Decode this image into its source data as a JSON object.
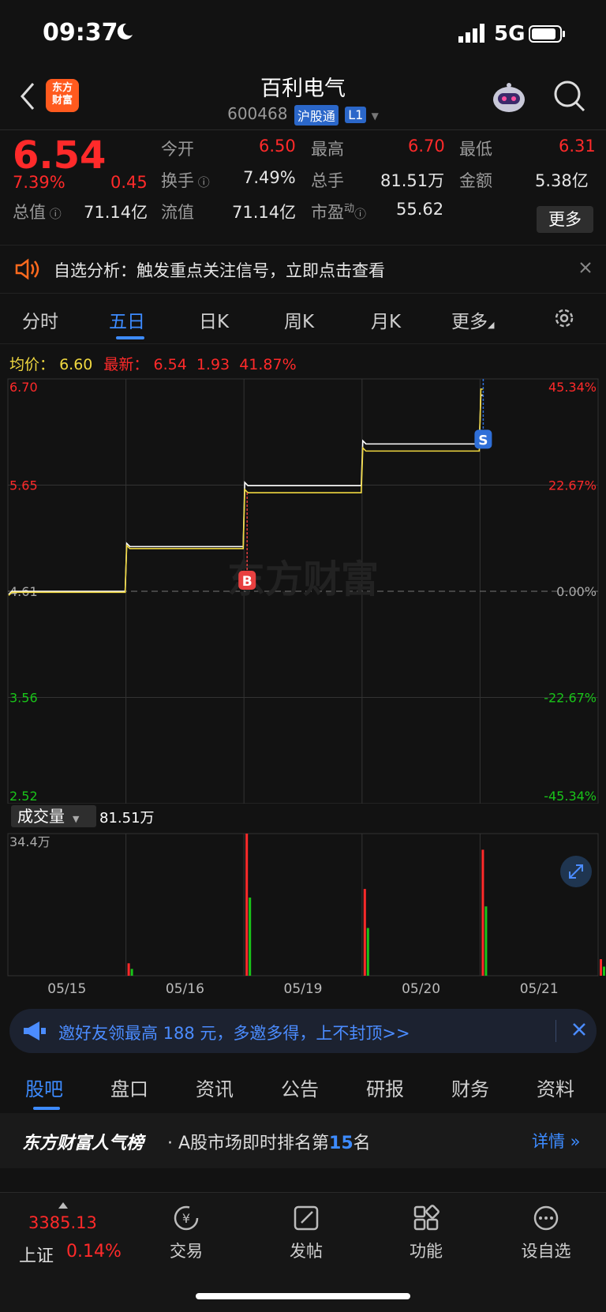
{
  "status": {
    "time": "09:37",
    "network": "5G"
  },
  "header": {
    "logo_line1": "东方",
    "logo_line2": "财富",
    "stock_name": "百利电气",
    "stock_code": "600468",
    "tag_connect": "沪股通",
    "tag_level": "L1"
  },
  "quote": {
    "price": "6.54",
    "change_pct": "7.39%",
    "change": "0.45",
    "open_label": "今开",
    "open": "6.50",
    "high_label": "最高",
    "high": "6.70",
    "low_label": "最低",
    "low": "6.31",
    "turnover_label": "换手",
    "turnover": "7.49%",
    "volume_label": "总手",
    "volume": "81.51万",
    "amount_label": "金额",
    "amount": "5.38亿",
    "mktcap_label": "总值",
    "mktcap": "71.14亿",
    "float_label": "流值",
    "float": "71.14亿",
    "pe_label": "市盈",
    "pe_sup": "动",
    "pe": "55.62",
    "more_label": "更多"
  },
  "notice": {
    "text": "自选分析：触发重点关注信号，立即点击查看"
  },
  "ktabs": [
    "分时",
    "五日",
    "日K",
    "周K",
    "月K",
    "更多"
  ],
  "avgline": {
    "avg_label": "均价：",
    "avg_value": "6.60",
    "latest_label": "最新：",
    "latest_value": "6.54",
    "vol_value": "1.93",
    "pct_value": "41.87%"
  },
  "chart_data": {
    "type": "line",
    "title": "",
    "x": [
      "05/15",
      "05/16",
      "05/19",
      "05/20",
      "05/21"
    ],
    "y_ticks": [
      "6.70",
      "5.65",
      "4.61",
      "3.56",
      "2.52"
    ],
    "y_pct_ticks": [
      "45.34%",
      "22.67%",
      "0.00%",
      "-22.67%",
      "-45.34%"
    ],
    "ylim": [
      2.52,
      6.7
    ],
    "series": [
      {
        "values": [
          4.61,
          5.05,
          5.65,
          6.06,
          6.54
        ]
      },
      {
        "values": [
          4.6,
          5.03,
          5.58,
          5.99,
          6.6
        ]
      }
    ],
    "markers": [
      {
        "day": "05/16",
        "label": "B"
      },
      {
        "day": "05/20",
        "label": "S"
      }
    ],
    "watermark": "东方财富",
    "volume": {
      "label": "成交量",
      "total": "81.51万",
      "max_label": "34.4万",
      "daily_peaks": [
        3.0,
        34.4,
        21.0,
        30.5,
        4.0
      ]
    }
  },
  "banner": {
    "text": "邀好友领最高 188 元，多邀多得，上不封顶>>"
  },
  "btabs": [
    "股吧",
    "盘口",
    "资讯",
    "公告",
    "研报",
    "财务",
    "资料"
  ],
  "rank": {
    "brand": "东方财富人气榜",
    "prefix": "· A股市场即时排名第",
    "num": "15",
    "suffix": "名",
    "detail": "详情 »"
  },
  "bnav": {
    "index_value": "3385.13",
    "index_name": "上证",
    "index_pct": "0.14%",
    "items": [
      "交易",
      "发帖",
      "功能",
      "设自选"
    ]
  },
  "colors": {
    "up": "#ff2a2a",
    "down": "#19c419",
    "accent": "#3d8bff",
    "bg": "#121212"
  }
}
